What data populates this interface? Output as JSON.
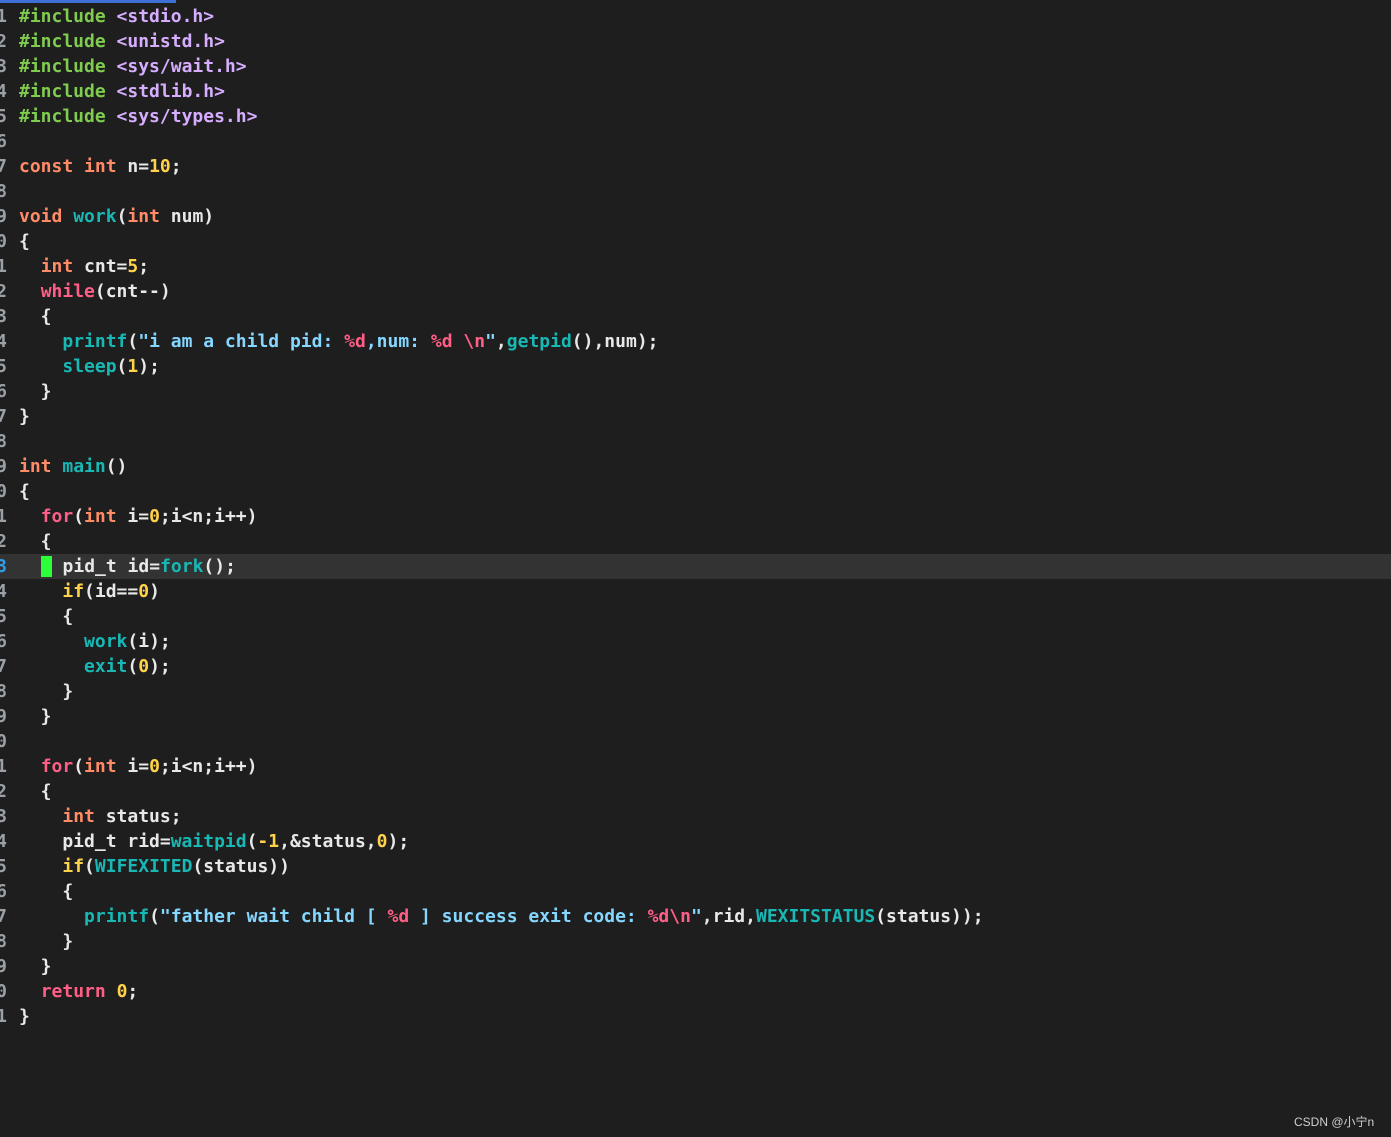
{
  "editor": {
    "current_line": 23,
    "lines": [
      {
        "number": "1",
        "tokens": [
          {
            "kind": "preproc",
            "text": "#include"
          },
          {
            "kind": "plain",
            "text": " "
          },
          {
            "kind": "include",
            "text": "<stdio.h>"
          }
        ]
      },
      {
        "number": "2",
        "tokens": [
          {
            "kind": "preproc",
            "text": "#include"
          },
          {
            "kind": "plain",
            "text": " "
          },
          {
            "kind": "include",
            "text": "<unistd.h>"
          }
        ]
      },
      {
        "number": "3",
        "tokens": [
          {
            "kind": "preproc",
            "text": "#include"
          },
          {
            "kind": "plain",
            "text": " "
          },
          {
            "kind": "include",
            "text": "<sys/wait.h>"
          }
        ]
      },
      {
        "number": "4",
        "tokens": [
          {
            "kind": "preproc",
            "text": "#include"
          },
          {
            "kind": "plain",
            "text": " "
          },
          {
            "kind": "include",
            "text": "<stdlib.h>"
          }
        ]
      },
      {
        "number": "5",
        "tokens": [
          {
            "kind": "preproc",
            "text": "#include"
          },
          {
            "kind": "plain",
            "text": " "
          },
          {
            "kind": "include",
            "text": "<sys/types.h>"
          }
        ]
      },
      {
        "number": "6",
        "tokens": []
      },
      {
        "number": "7",
        "tokens": [
          {
            "kind": "type",
            "text": "const"
          },
          {
            "kind": "plain",
            "text": " "
          },
          {
            "kind": "type",
            "text": "int"
          },
          {
            "kind": "plain",
            "text": " "
          },
          {
            "kind": "ident",
            "text": "n="
          },
          {
            "kind": "number",
            "text": "10"
          },
          {
            "kind": "plain",
            "text": ";"
          }
        ]
      },
      {
        "number": "8",
        "tokens": []
      },
      {
        "number": "9",
        "tokens": [
          {
            "kind": "type",
            "text": "void"
          },
          {
            "kind": "plain",
            "text": " "
          },
          {
            "kind": "func",
            "text": "work"
          },
          {
            "kind": "plain",
            "text": "("
          },
          {
            "kind": "type",
            "text": "int"
          },
          {
            "kind": "plain",
            "text": " "
          },
          {
            "kind": "ident",
            "text": "num"
          },
          {
            "kind": "plain",
            "text": ")"
          }
        ]
      },
      {
        "number": "0",
        "tokens": [
          {
            "kind": "plain",
            "text": "{"
          }
        ]
      },
      {
        "number": "1",
        "tokens": [
          {
            "kind": "plain",
            "text": "  "
          },
          {
            "kind": "type",
            "text": "int"
          },
          {
            "kind": "plain",
            "text": " "
          },
          {
            "kind": "ident",
            "text": "cnt="
          },
          {
            "kind": "number",
            "text": "5"
          },
          {
            "kind": "plain",
            "text": ";"
          }
        ]
      },
      {
        "number": "2",
        "tokens": [
          {
            "kind": "plain",
            "text": "  "
          },
          {
            "kind": "keyword",
            "text": "while"
          },
          {
            "kind": "plain",
            "text": "(cnt--)"
          }
        ]
      },
      {
        "number": "3",
        "tokens": [
          {
            "kind": "plain",
            "text": "  {"
          }
        ]
      },
      {
        "number": "4",
        "tokens": [
          {
            "kind": "plain",
            "text": "    "
          },
          {
            "kind": "func",
            "text": "printf"
          },
          {
            "kind": "plain",
            "text": "("
          },
          {
            "kind": "string",
            "text": "\"i am a child pid: "
          },
          {
            "kind": "format",
            "text": "%d"
          },
          {
            "kind": "string",
            "text": ",num: "
          },
          {
            "kind": "format",
            "text": "%d"
          },
          {
            "kind": "string",
            "text": " "
          },
          {
            "kind": "format",
            "text": "\\n"
          },
          {
            "kind": "string",
            "text": "\""
          },
          {
            "kind": "plain",
            "text": ","
          },
          {
            "kind": "func",
            "text": "getpid"
          },
          {
            "kind": "plain",
            "text": "(),num);"
          }
        ]
      },
      {
        "number": "5",
        "tokens": [
          {
            "kind": "plain",
            "text": "    "
          },
          {
            "kind": "func",
            "text": "sleep"
          },
          {
            "kind": "plain",
            "text": "("
          },
          {
            "kind": "number",
            "text": "1"
          },
          {
            "kind": "plain",
            "text": ");"
          }
        ]
      },
      {
        "number": "6",
        "tokens": [
          {
            "kind": "plain",
            "text": "  }"
          }
        ]
      },
      {
        "number": "7",
        "tokens": [
          {
            "kind": "plain",
            "text": "}"
          }
        ]
      },
      {
        "number": "8",
        "tokens": []
      },
      {
        "number": "9",
        "tokens": [
          {
            "kind": "type",
            "text": "int"
          },
          {
            "kind": "plain",
            "text": " "
          },
          {
            "kind": "func",
            "text": "main"
          },
          {
            "kind": "plain",
            "text": "()"
          }
        ]
      },
      {
        "number": "0",
        "tokens": [
          {
            "kind": "plain",
            "text": "{"
          }
        ]
      },
      {
        "number": "1",
        "tokens": [
          {
            "kind": "plain",
            "text": "  "
          },
          {
            "kind": "keyword",
            "text": "for"
          },
          {
            "kind": "plain",
            "text": "("
          },
          {
            "kind": "type",
            "text": "int"
          },
          {
            "kind": "plain",
            "text": " i="
          },
          {
            "kind": "number",
            "text": "0"
          },
          {
            "kind": "plain",
            "text": ";i<n;i++)"
          }
        ]
      },
      {
        "number": "2",
        "tokens": [
          {
            "kind": "plain",
            "text": "  {"
          }
        ]
      },
      {
        "number": "3",
        "cursor": true,
        "tokens": [
          {
            "kind": "plain",
            "text": "  "
          },
          {
            "kind": "cursor",
            "text": ""
          },
          {
            "kind": "plain",
            "text": " pid_t id="
          },
          {
            "kind": "func",
            "text": "fork"
          },
          {
            "kind": "plain",
            "text": "();"
          }
        ]
      },
      {
        "number": "4",
        "tokens": [
          {
            "kind": "plain",
            "text": "    "
          },
          {
            "kind": "number",
            "text": "if"
          },
          {
            "kind": "plain",
            "text": "(id=="
          },
          {
            "kind": "number",
            "text": "0"
          },
          {
            "kind": "plain",
            "text": ")"
          }
        ]
      },
      {
        "number": "5",
        "tokens": [
          {
            "kind": "plain",
            "text": "    {"
          }
        ]
      },
      {
        "number": "6",
        "tokens": [
          {
            "kind": "plain",
            "text": "      "
          },
          {
            "kind": "func",
            "text": "work"
          },
          {
            "kind": "plain",
            "text": "(i);"
          }
        ]
      },
      {
        "number": "7",
        "tokens": [
          {
            "kind": "plain",
            "text": "      "
          },
          {
            "kind": "func",
            "text": "exit"
          },
          {
            "kind": "plain",
            "text": "("
          },
          {
            "kind": "number",
            "text": "0"
          },
          {
            "kind": "plain",
            "text": ");"
          }
        ]
      },
      {
        "number": "8",
        "tokens": [
          {
            "kind": "plain",
            "text": "    }"
          }
        ]
      },
      {
        "number": "9",
        "tokens": [
          {
            "kind": "plain",
            "text": "  }"
          }
        ]
      },
      {
        "number": "0",
        "tokens": []
      },
      {
        "number": "1",
        "tokens": [
          {
            "kind": "plain",
            "text": "  "
          },
          {
            "kind": "keyword",
            "text": "for"
          },
          {
            "kind": "plain",
            "text": "("
          },
          {
            "kind": "type",
            "text": "int"
          },
          {
            "kind": "plain",
            "text": " i="
          },
          {
            "kind": "number",
            "text": "0"
          },
          {
            "kind": "plain",
            "text": ";i<n;i++)"
          }
        ]
      },
      {
        "number": "2",
        "tokens": [
          {
            "kind": "plain",
            "text": "  {"
          }
        ]
      },
      {
        "number": "3",
        "tokens": [
          {
            "kind": "plain",
            "text": "    "
          },
          {
            "kind": "type",
            "text": "int"
          },
          {
            "kind": "plain",
            "text": " status;"
          }
        ]
      },
      {
        "number": "4",
        "tokens": [
          {
            "kind": "plain",
            "text": "    pid_t rid="
          },
          {
            "kind": "func",
            "text": "waitpid"
          },
          {
            "kind": "plain",
            "text": "("
          },
          {
            "kind": "number",
            "text": "-1"
          },
          {
            "kind": "plain",
            "text": ",&status,"
          },
          {
            "kind": "number",
            "text": "0"
          },
          {
            "kind": "plain",
            "text": ");"
          }
        ]
      },
      {
        "number": "5",
        "tokens": [
          {
            "kind": "plain",
            "text": "    "
          },
          {
            "kind": "number",
            "text": "if"
          },
          {
            "kind": "plain",
            "text": "("
          },
          {
            "kind": "func",
            "text": "WIFEXITED"
          },
          {
            "kind": "plain",
            "text": "(status))"
          }
        ]
      },
      {
        "number": "6",
        "tokens": [
          {
            "kind": "plain",
            "text": "    {"
          }
        ]
      },
      {
        "number": "7",
        "tokens": [
          {
            "kind": "plain",
            "text": "      "
          },
          {
            "kind": "func",
            "text": "printf"
          },
          {
            "kind": "plain",
            "text": "("
          },
          {
            "kind": "string",
            "text": "\"father wait child [ "
          },
          {
            "kind": "format",
            "text": "%d"
          },
          {
            "kind": "string",
            "text": " ] success exit code: "
          },
          {
            "kind": "format",
            "text": "%d\\n"
          },
          {
            "kind": "string",
            "text": "\""
          },
          {
            "kind": "plain",
            "text": ",rid,"
          },
          {
            "kind": "func",
            "text": "WEXITSTATUS"
          },
          {
            "kind": "plain",
            "text": "(status));"
          }
        ]
      },
      {
        "number": "8",
        "tokens": [
          {
            "kind": "plain",
            "text": "    }"
          }
        ]
      },
      {
        "number": "9",
        "tokens": [
          {
            "kind": "plain",
            "text": "  }"
          }
        ]
      },
      {
        "number": "0",
        "tokens": [
          {
            "kind": "plain",
            "text": "  "
          },
          {
            "kind": "keyword",
            "text": "return"
          },
          {
            "kind": "plain",
            "text": " "
          },
          {
            "kind": "number",
            "text": "0"
          },
          {
            "kind": "plain",
            "text": ";"
          }
        ]
      },
      {
        "number": "1",
        "tokens": [
          {
            "kind": "plain",
            "text": "}"
          }
        ]
      }
    ]
  },
  "watermark": {
    "text": "CSDN @小宁n"
  },
  "colors": {
    "background": "#1e1e1e",
    "current_line_background": "#333333",
    "cursor": "#2cff39",
    "preproc": "#7fcc4f",
    "include": "#d7aeff",
    "keyword": "#ff5f86",
    "type": "#ff8c66",
    "function": "#18b8b5",
    "number": "#ffd24a",
    "string": "#86d7ff"
  }
}
